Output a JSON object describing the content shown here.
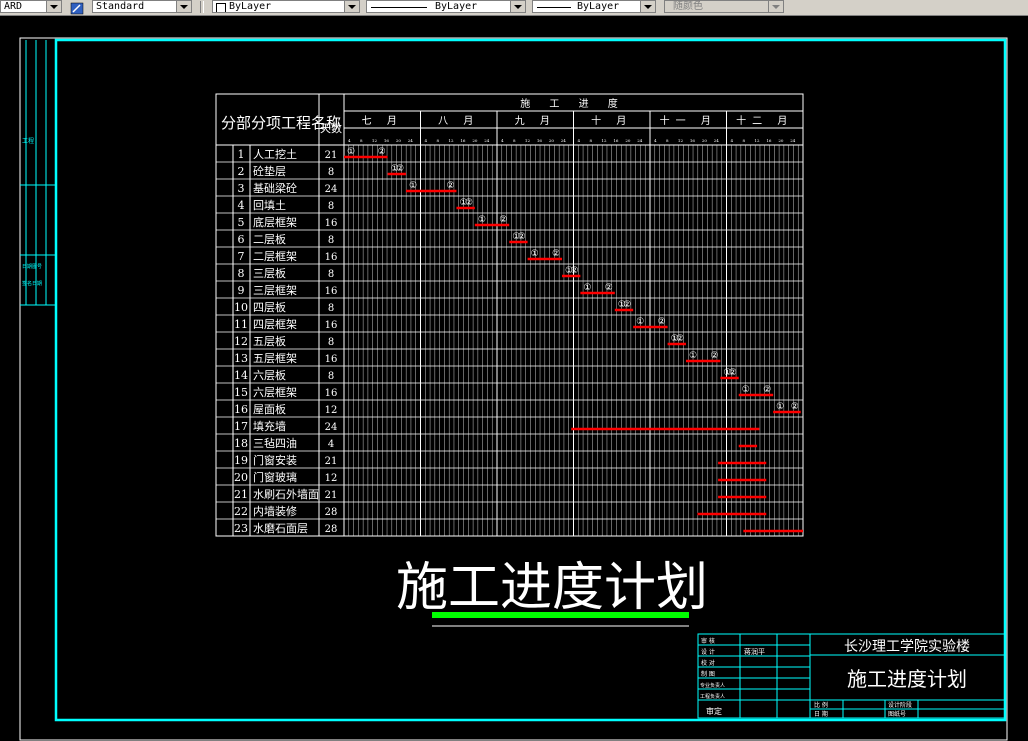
{
  "toolbar": {
    "left_combo_fragment": "ARD",
    "text_style": "Standard",
    "layer": "ByLayer",
    "linetype": "ByLayer",
    "lineweight": "ByLayer",
    "color": "随颜色"
  },
  "drawing": {
    "left_strip_labels": [
      "工程",
      "日期图号",
      "签名日期"
    ],
    "schedule": {
      "header_item": "分部分项工程名称",
      "header_days": "天数",
      "header_progress": "施 工 进 度",
      "months": [
        "七 月",
        "八 月",
        "九 月",
        "十 月",
        "十一 月",
        "十二 月"
      ],
      "day_ticks": [
        [
          "4",
          "8",
          "12",
          "16",
          "20",
          "24"
        ],
        [
          "4",
          "8",
          "12",
          "16",
          "20",
          "24"
        ],
        [
          "4",
          "8",
          "12",
          "16",
          "20",
          "24"
        ],
        [
          "4",
          "8",
          "12",
          "16",
          "20",
          "24"
        ],
        [
          "4",
          "8",
          "12",
          "16",
          "20",
          "24"
        ],
        [
          "4",
          "8",
          "12",
          "16",
          "20",
          "24"
        ]
      ],
      "rows": [
        {
          "no": "1",
          "name": "人工挖土",
          "days": "21",
          "bar": [
            0.0,
            0.095
          ],
          "m1": "①",
          "m2": "②"
        },
        {
          "no": "2",
          "name": "砼垫层",
          "days": "8",
          "bar": [
            0.095,
            0.135
          ],
          "m1": "①",
          "m2": "②"
        },
        {
          "no": "3",
          "name": "基础梁砼",
          "days": "24",
          "bar": [
            0.135,
            0.245
          ],
          "m1": "①",
          "m2": "②"
        },
        {
          "no": "4",
          "name": "回填土",
          "days": "8",
          "bar": [
            0.245,
            0.285
          ],
          "m1": "①",
          "m2": "②"
        },
        {
          "no": "5",
          "name": "底层框架",
          "days": "16",
          "bar": [
            0.285,
            0.36
          ],
          "m1": "①",
          "m2": "②"
        },
        {
          "no": "6",
          "name": "二层板",
          "days": "8",
          "bar": [
            0.36,
            0.4
          ],
          "m1": "①",
          "m2": "②"
        },
        {
          "no": "7",
          "name": "二层框架",
          "days": "16",
          "bar": [
            0.4,
            0.475
          ],
          "m1": "①",
          "m2": "②"
        },
        {
          "no": "8",
          "name": "三层板",
          "days": "8",
          "bar": [
            0.475,
            0.515
          ],
          "m1": "①",
          "m2": "②"
        },
        {
          "no": "9",
          "name": "三层框架",
          "days": "16",
          "bar": [
            0.515,
            0.59
          ],
          "m1": "①",
          "m2": "②"
        },
        {
          "no": "10",
          "name": "四层板",
          "days": "8",
          "bar": [
            0.59,
            0.63
          ],
          "m1": "①",
          "m2": "②"
        },
        {
          "no": "11",
          "name": "四层框架",
          "days": "16",
          "bar": [
            0.63,
            0.705
          ],
          "m1": "①",
          "m2": "②"
        },
        {
          "no": "12",
          "name": "五层板",
          "days": "8",
          "bar": [
            0.705,
            0.745
          ],
          "m1": "①",
          "m2": "②"
        },
        {
          "no": "13",
          "name": "五层框架",
          "days": "16",
          "bar": [
            0.745,
            0.82
          ],
          "m1": "①",
          "m2": "②"
        },
        {
          "no": "14",
          "name": "六层板",
          "days": "8",
          "bar": [
            0.82,
            0.86
          ],
          "m1": "①",
          "m2": "②"
        },
        {
          "no": "15",
          "name": "六层框架",
          "days": "16",
          "bar": [
            0.86,
            0.935
          ],
          "m1": "①",
          "m2": "②"
        },
        {
          "no": "16",
          "name": "屋面板",
          "days": "12",
          "bar": [
            0.935,
            0.995
          ],
          "m1": "①",
          "m2": "②"
        },
        {
          "no": "17",
          "name": "填充墙",
          "days": "24",
          "bar": [
            0.495,
            0.905
          ],
          "m1": "",
          "m2": ""
        },
        {
          "no": "18",
          "name": "三毡四油",
          "days": "4",
          "bar": [
            0.86,
            0.9
          ],
          "m1": "",
          "m2": ""
        },
        {
          "no": "19",
          "name": "门窗安装",
          "days": "21",
          "bar": [
            0.815,
            0.92
          ],
          "m1": "",
          "m2": ""
        },
        {
          "no": "20",
          "name": "门窗玻璃",
          "days": "12",
          "bar": [
            0.815,
            0.92
          ],
          "m1": "",
          "m2": ""
        },
        {
          "no": "21",
          "name": "水刷石外墙面",
          "days": "21",
          "bar": [
            0.815,
            0.92
          ],
          "m1": "",
          "m2": ""
        },
        {
          "no": "22",
          "name": "内墙装修",
          "days": "28",
          "bar": [
            0.77,
            0.92
          ],
          "m1": "",
          "m2": ""
        },
        {
          "no": "23",
          "name": "水磨石面层",
          "days": "28",
          "bar": [
            0.87,
            1.0
          ],
          "m1": "",
          "m2": ""
        }
      ]
    },
    "big_title": "施工进度计划",
    "title_block": {
      "project": "长沙理工学院实验楼",
      "drawing_name": "施工进度计划",
      "left_labels": [
        "审 核",
        "设 计",
        "校 对",
        "制 图",
        "专业负责人",
        "工程负责人"
      ],
      "designer_name": "蒋润平",
      "approve": "审定",
      "bottom_labels": [
        "比 例",
        "日 期"
      ],
      "bottom_right_labels": [
        "设计阶段",
        "图纸号"
      ]
    },
    "colors": {
      "frame": "#00ffff",
      "bar": "#ff0000",
      "underline_green": "#00ff00",
      "text": "#ffffff"
    }
  }
}
